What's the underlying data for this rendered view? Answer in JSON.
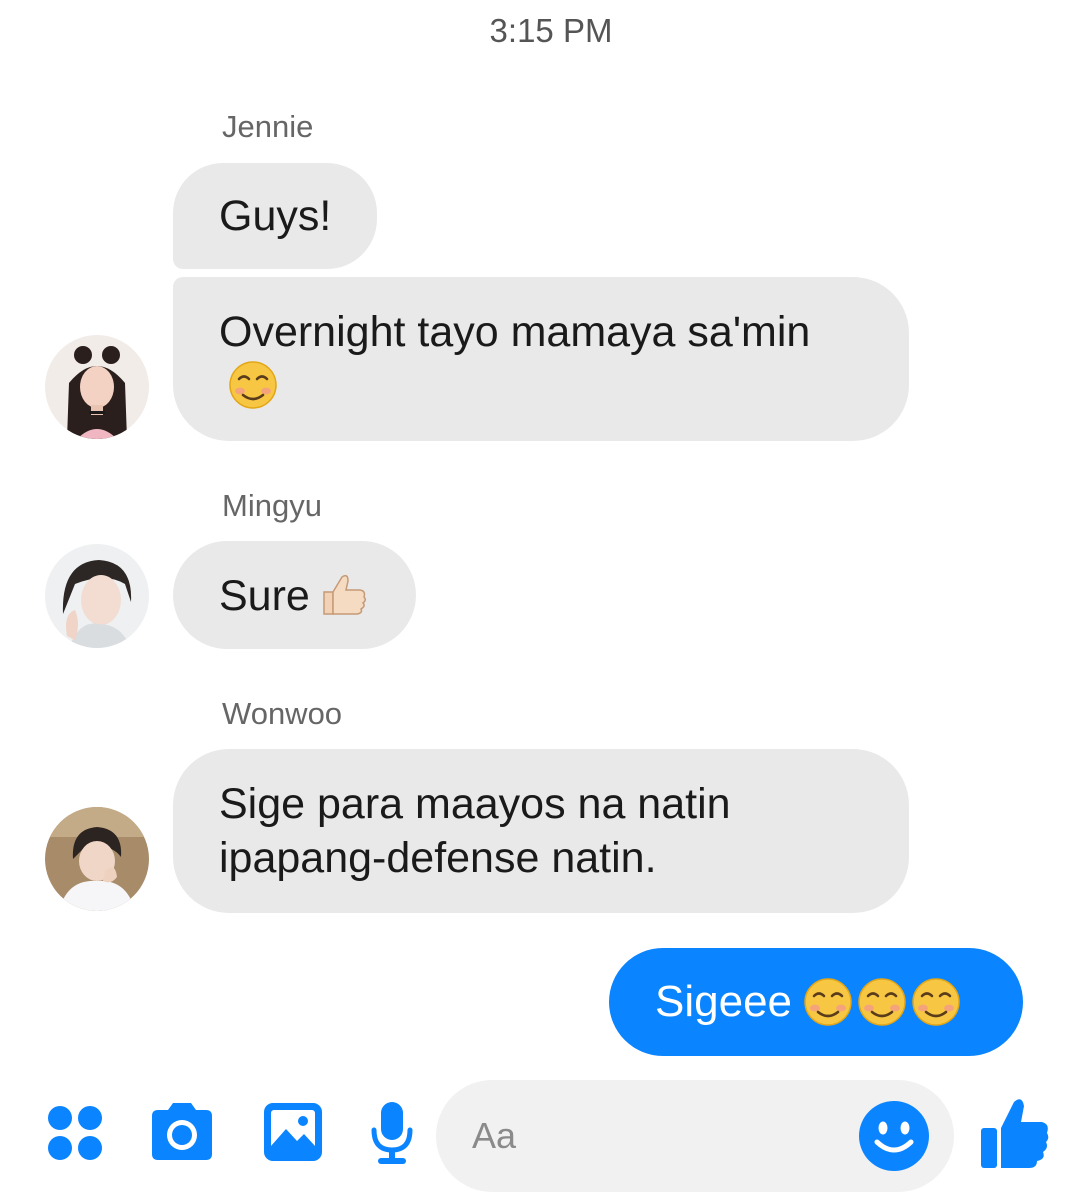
{
  "timestamp": "3:15 PM",
  "messages": [
    {
      "sender": "Jennie",
      "texts": [
        "Guys!",
        "Overnight tayo mamaya sa'min"
      ]
    },
    {
      "sender": "Mingyu",
      "texts": [
        "Sure"
      ]
    },
    {
      "sender": "Wonwoo",
      "texts": [
        "Sige para maayos na natin ipapang-defense natin."
      ]
    }
  ],
  "outgoing": {
    "text": "Sigeee"
  },
  "emoji": {
    "smiling": "smiling-face-emoji",
    "thumbs_up": "thumbs-up-emoji"
  },
  "composer": {
    "placeholder": "Aa",
    "icons": [
      "apps-icon",
      "camera-icon",
      "gallery-icon",
      "microphone-icon",
      "emoji-icon",
      "like-thumbs-up-icon"
    ]
  },
  "colors": {
    "accent": "#0a84ff",
    "incoming_bubble": "#e9e9e9",
    "composer_bg": "#f1f1f1"
  }
}
